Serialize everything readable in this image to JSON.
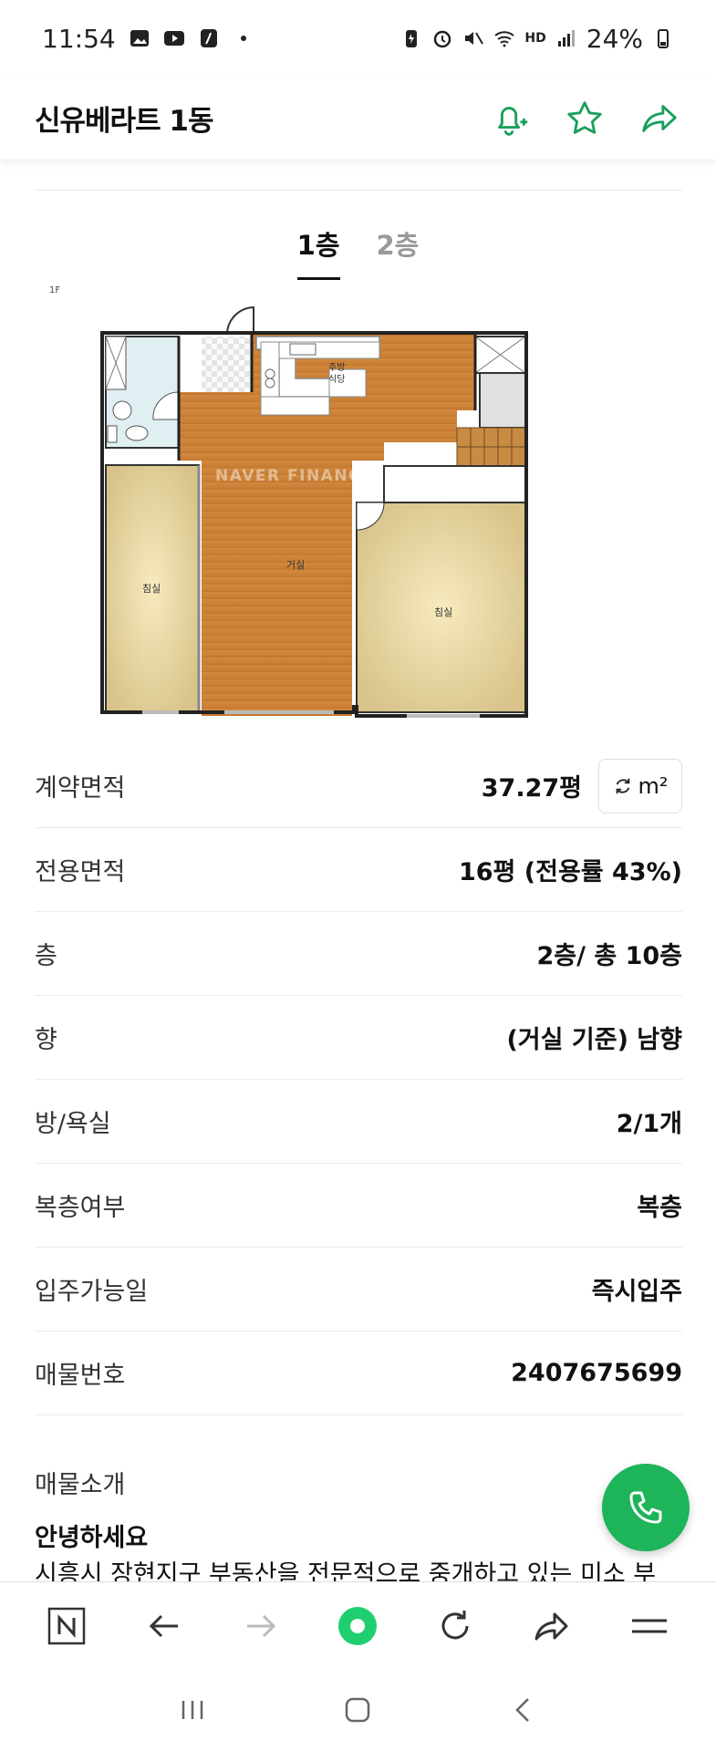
{
  "status_bar": {
    "time": "11:54",
    "network_label": "HD",
    "battery": "24%"
  },
  "header": {
    "title": "신유베라트 1동"
  },
  "floor_tabs": [
    {
      "label": "1층",
      "active": true
    },
    {
      "label": "2층",
      "active": false
    }
  ],
  "floorplan": {
    "floor_label": "1F",
    "watermark": "NAVER FINANCIAL",
    "rooms": {
      "kitchen": "주방",
      "dining": "식당",
      "living": "거실",
      "bedroom_left": "침실",
      "bedroom_right": "침실"
    }
  },
  "details": [
    {
      "label": "계약면적",
      "value": "37.27평"
    },
    {
      "label": "전용면적",
      "value": "16평 (전용률 43%)"
    },
    {
      "label": "층",
      "value": "2층/ 총 10층"
    },
    {
      "label": "향",
      "value": "(거실 기준) 남향"
    },
    {
      "label": "방/욕실",
      "value": "2/1개"
    },
    {
      "label": "복층여부",
      "value": "복층"
    },
    {
      "label": "입주가능일",
      "value": "즉시입주"
    },
    {
      "label": "매물번호",
      "value": "2407675699"
    }
  ],
  "unit_toggle": {
    "label": "m²"
  },
  "intro": {
    "label": "매물소개",
    "greeting": "안녕하세요",
    "text": "시흥시 장현지구 부동산을 전문적으로 중개하고 있는 미소 부"
  },
  "colors": {
    "accent_green": "#1db45a",
    "icon_green": "#19a05a"
  }
}
